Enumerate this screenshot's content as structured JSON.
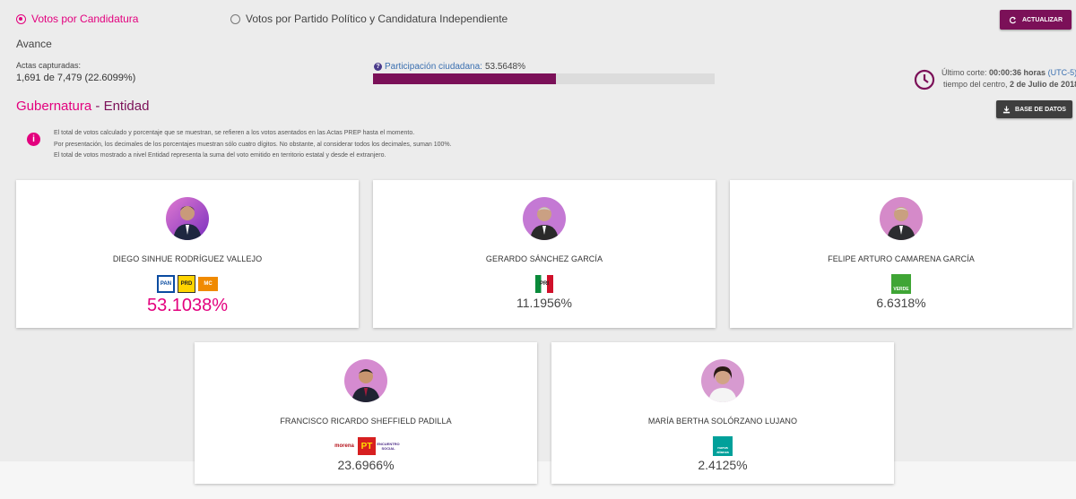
{
  "tabs": {
    "candidatura": "Votos por Candidatura",
    "partido": "Votos por Partido Político y Candidatura Independiente"
  },
  "actualizar_label": "ACTUALIZAR",
  "avance": "Avance",
  "actas": {
    "label": "Actas capturadas:",
    "value": "1,691 de 7,479",
    "pct": "(22.6099%)"
  },
  "participacion": {
    "label": "Participación ciudadana:",
    "value": "53.5648%",
    "fraction": 0.535648
  },
  "corte": {
    "prefix": "Último corte: ",
    "time": "00:00:36 horas",
    "tz": "(UTC-5)",
    "line2_prefix": "tiempo del centro, ",
    "date": "2 de Julio de 2018"
  },
  "section": {
    "title_a": "Gubernatura",
    "title_sep": " - ",
    "title_b": "Entidad"
  },
  "base_datos_label": "BASE DE DATOS",
  "notes": [
    "El total de votos calculado y porcentaje que se muestran, se refieren a los votos asentados en las Actas PREP hasta el momento.",
    "Por presentación, los decimales de los porcentajes muestran sólo cuatro dígitos. No obstante, al considerar todos los decimales, suman 100%.",
    "El total de votos mostrado a nivel Entidad representa la suma del voto emitido en territorio estatal y desde el extranjero."
  ],
  "candidates": [
    {
      "name": "DIEGO SINHUE RODRÍGUEZ VALLEJO",
      "pct": "53.1038%",
      "parties": [
        "PAN",
        "PRD",
        "MC"
      ]
    },
    {
      "name": "GERARDO SÁNCHEZ GARCÍA",
      "pct": "11.1956%",
      "parties": [
        "PRI"
      ]
    },
    {
      "name": "FELIPE ARTURO CAMARENA GARCÍA",
      "pct": "6.6318%",
      "parties": [
        "VERDE"
      ]
    },
    {
      "name": "FRANCISCO RICARDO SHEFFIELD PADILLA",
      "pct": "23.6966%",
      "parties": [
        "morena",
        "PT",
        "ENCUENTRO SOCIAL"
      ]
    },
    {
      "name": "MARÍA BERTHA SOLÓRZANO LUJANO",
      "pct": "2.4125%",
      "parties": [
        "nueva alianza"
      ]
    }
  ],
  "colors": {
    "accent": "#e3007e",
    "purple": "#7b1058",
    "dark": "#3e3e3e"
  }
}
